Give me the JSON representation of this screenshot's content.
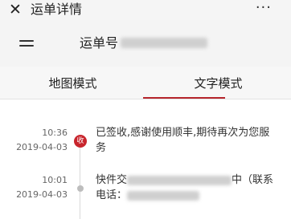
{
  "titlebar": {
    "close_icon": "close-icon",
    "title": "运单详情",
    "more_icon": "ellipsis-icon",
    "more_label": "···"
  },
  "waybill": {
    "label": "运单号"
  },
  "tabs": [
    {
      "label": "地图模式",
      "active": false
    },
    {
      "label": "文字模式",
      "active": true
    }
  ],
  "accent_color": "#b6252c",
  "timeline": [
    {
      "time": "10:36",
      "date": "2019-04-03",
      "badge": "收",
      "text": "已签收,感谢使用顺丰,期待再次为您服务"
    },
    {
      "time": "10:01",
      "date": "2019-04-03",
      "text_start": "快件交",
      "text_mid": "中（联系",
      "text_phone_label": "电话："
    }
  ]
}
